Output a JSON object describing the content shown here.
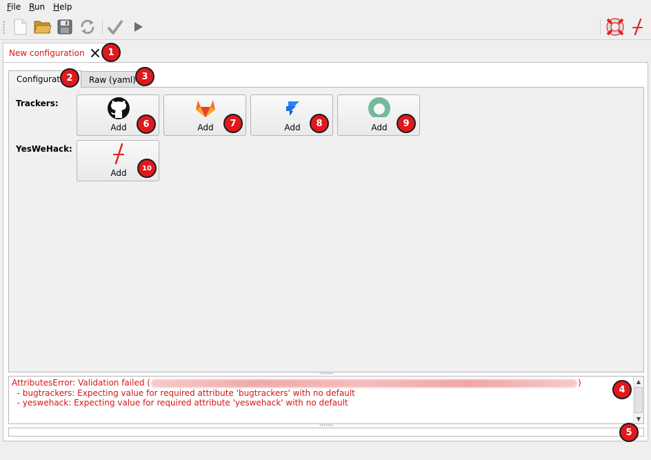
{
  "menu": [
    {
      "label": "File",
      "mnemonic": "F",
      "rest": "ile"
    },
    {
      "label": "Run",
      "mnemonic": "R",
      "rest": "un"
    },
    {
      "label": "Help",
      "mnemonic": "H",
      "rest": "elp"
    }
  ],
  "toolbar": {
    "buttons": [
      "new-file-icon",
      "open-folder-icon",
      "save-icon",
      "reload-icon",
      "validate-check-icon",
      "run-play-icon"
    ],
    "right_buttons": [
      "lifebuoy-icon",
      "yeswehack-logo-icon"
    ]
  },
  "document_tab": {
    "label": "New configuration",
    "close_icon": "close-icon"
  },
  "inner_tabs": [
    {
      "label": "Configuration",
      "active": true
    },
    {
      "label": "Raw (yaml)",
      "active": false
    }
  ],
  "rows": [
    {
      "label": "Trackers:",
      "buttons": [
        {
          "label": "Add",
          "icon": "github-icon"
        },
        {
          "label": "Add",
          "icon": "gitlab-icon"
        },
        {
          "label": "Add",
          "icon": "jira-icon"
        },
        {
          "label": "Add",
          "icon": "redmine-icon"
        }
      ]
    },
    {
      "label": "YesWeHack:",
      "buttons": [
        {
          "label": "Add",
          "icon": "yeswehack-icon"
        }
      ]
    }
  ],
  "log": {
    "line1_prefix": "AttributesError: Validation failed (",
    "line1_suffix": ")",
    "line2": "  - bugtrackers: Expecting value for required attribute 'bugtrackers' with no default",
    "line3": "  - yeswehack: Expecting value for required attribute 'yeswehack' with no default"
  },
  "markers": [
    "1",
    "2",
    "3",
    "4",
    "5",
    "6",
    "7",
    "8",
    "9",
    "10"
  ],
  "colors": {
    "error_red": "#d71414",
    "marker_red": "#e0191c",
    "ywh_red": "#e3262b"
  }
}
